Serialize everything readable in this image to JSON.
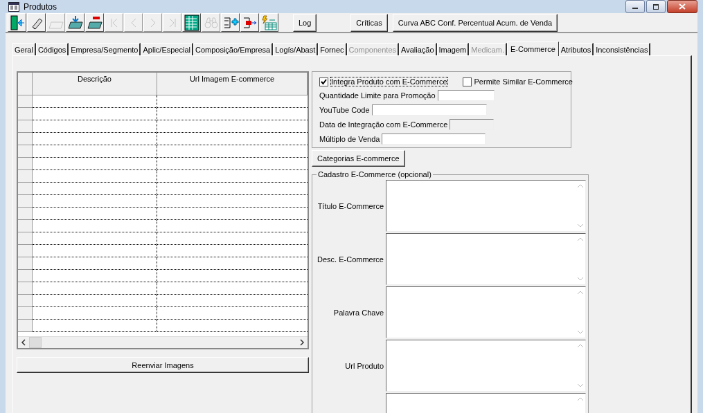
{
  "window": {
    "title": "Produtos"
  },
  "toolbar": {
    "icons": [
      {
        "kind": "exit",
        "disabled": false
      },
      {
        "kind": "eraser",
        "disabled": false
      },
      {
        "kind": "folder",
        "disabled": true
      },
      {
        "kind": "download",
        "disabled": false
      },
      {
        "kind": "remove",
        "disabled": false
      },
      {
        "kind": "first",
        "disabled": true
      },
      {
        "kind": "prev",
        "disabled": true
      },
      {
        "kind": "next",
        "disabled": true
      },
      {
        "kind": "last",
        "disabled": true
      },
      {
        "kind": "grid",
        "disabled": false
      },
      {
        "kind": "binoculars",
        "disabled": true
      },
      {
        "kind": "add",
        "disabled": false
      },
      {
        "kind": "export",
        "disabled": false
      },
      {
        "kind": "table",
        "disabled": false
      }
    ],
    "buttons": [
      "Log",
      "Críticas",
      "Curva ABC Conf. Percentual Acum. de Venda"
    ]
  },
  "tabs": [
    {
      "label": "Geral",
      "selected": false,
      "disabled": false
    },
    {
      "label": "Códigos",
      "selected": false,
      "disabled": false
    },
    {
      "label": "Empresa/Segmento",
      "selected": false,
      "disabled": false
    },
    {
      "label": "Aplic/Especial",
      "selected": false,
      "disabled": false
    },
    {
      "label": "Composição/Empresa",
      "selected": false,
      "disabled": false
    },
    {
      "label": "Logís/Abast",
      "selected": false,
      "disabled": false
    },
    {
      "label": "Fornec",
      "selected": false,
      "disabled": false
    },
    {
      "label": "Componentes",
      "selected": false,
      "disabled": true
    },
    {
      "label": "Avaliação",
      "selected": false,
      "disabled": false
    },
    {
      "label": "Imagem",
      "selected": false,
      "disabled": false
    },
    {
      "label": "Medicam.",
      "selected": false,
      "disabled": true
    },
    {
      "label": "E-Commerce",
      "selected": true,
      "disabled": false
    },
    {
      "label": "Atributos",
      "selected": false,
      "disabled": false
    },
    {
      "label": "Inconsistências",
      "selected": false,
      "disabled": false
    }
  ],
  "table": {
    "columns": [
      "Descrição",
      "Url Imagem E-commerce"
    ]
  },
  "resend_button": "Reenviar Imagens",
  "options": {
    "checkboxes": [
      {
        "label": "Integra Produto com E-Commerce",
        "checked": true
      },
      {
        "label": "Permite Similar E-Commerce",
        "checked": false
      }
    ],
    "fields": [
      {
        "label": "Quantidade Limite para Promoção",
        "disabled": false
      },
      {
        "label": "YouTube Code",
        "disabled": false
      },
      {
        "label": "Data de Integração com E-Commerce",
        "disabled": true
      },
      {
        "label": "Múltiplo de Venda",
        "disabled": false
      }
    ]
  },
  "categories_button": "Categorias E-commerce",
  "cadastro": {
    "title": "Cadastro E-Commerce (opcional)",
    "fields": [
      {
        "kind": "textarea",
        "label": "Título E-Commerce"
      },
      {
        "kind": "textarea",
        "label": "Desc. E-Commerce"
      },
      {
        "kind": "textarea",
        "label": "Palavra Chave"
      },
      {
        "kind": "textarea",
        "label": "Url Produto"
      },
      {
        "kind": "textarea"
      }
    ]
  }
}
